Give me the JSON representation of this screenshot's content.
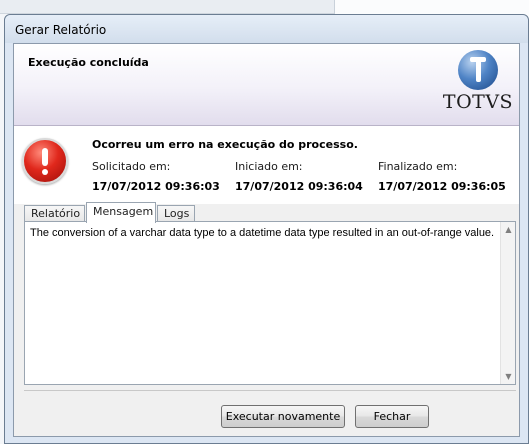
{
  "window": {
    "title": "Gerar Relatório"
  },
  "header": {
    "heading": "Execução concluída",
    "logo_text": "TOTVS"
  },
  "status": {
    "icon": "error-icon",
    "message": "Ocorreu um erro na execução do processo.",
    "requested_label": "Solicitado em:",
    "requested_value": "17/07/2012 09:36:03",
    "started_label": "Iniciado em:",
    "started_value": "17/07/2012 09:36:04",
    "finished_label": "Finalizado em:",
    "finished_value": "17/07/2012 09:36:05"
  },
  "tabs": [
    {
      "label": "Relatório",
      "active": false
    },
    {
      "label": "Mensagem",
      "active": true
    },
    {
      "label": "Logs",
      "active": false
    }
  ],
  "message_text": "The conversion of a varchar data type to a datetime data type resulted in an out-of-range value.",
  "buttons": {
    "rerun": "Executar novamente",
    "close": "Fechar"
  }
}
